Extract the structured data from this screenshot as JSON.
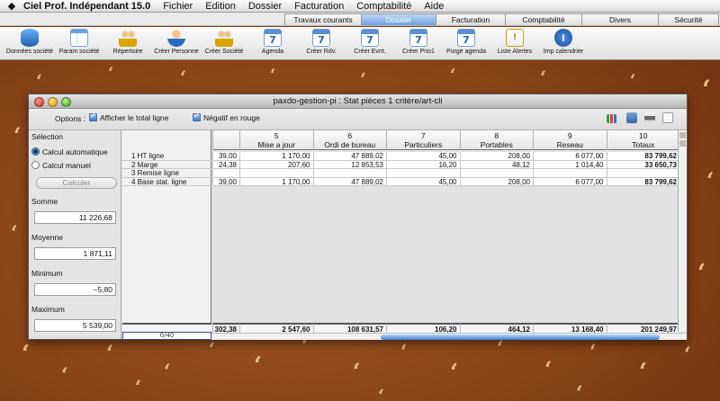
{
  "menubar": {
    "app_name": "Ciel Prof. Indépendant 15.0",
    "items": [
      "Fichier",
      "Edition",
      "Dossier",
      "Facturation",
      "Comptabilité",
      "Aide"
    ]
  },
  "tabs": [
    {
      "label": "Travaux courants",
      "active": false
    },
    {
      "label": "Dossier",
      "active": true
    },
    {
      "label": "Facturation",
      "active": false
    },
    {
      "label": "Comptabilité",
      "active": false
    },
    {
      "label": "Divers",
      "active": false
    },
    {
      "label": "Sécurité",
      "active": false
    }
  ],
  "toolbar": [
    {
      "label": "Données société",
      "icon": "database-info-icon"
    },
    {
      "label": "Param société",
      "icon": "window-settings-icon"
    },
    {
      "label": "Répertoire",
      "icon": "directory-people-icon"
    },
    {
      "label": "Créer Personne",
      "icon": "add-person-icon"
    },
    {
      "label": "Créer Société",
      "icon": "add-company-icon"
    },
    {
      "label": "Agenda",
      "icon": "calendar-icon",
      "cal": "7"
    },
    {
      "label": "Créer Rdv.",
      "icon": "calendar-icon",
      "cal": "7"
    },
    {
      "label": "Créer Evnt.",
      "icon": "calendar-icon",
      "cal": "7"
    },
    {
      "label": "Créer Prio1",
      "icon": "calendar-icon",
      "cal": "7"
    },
    {
      "label": "Purge agenda",
      "icon": "calendar-icon",
      "cal": "7"
    },
    {
      "label": "Liste Alertes",
      "icon": "warning-icon"
    },
    {
      "label": "Imp calendrier",
      "icon": "info-icon"
    }
  ],
  "window": {
    "title": "paxdo-gestion-pi : Stat pièces 1 critère/art-cli",
    "options_label": "Options :",
    "opt_total": "Afficher le total ligne",
    "opt_negative": "Négatif en rouge"
  },
  "left_panel": {
    "selection": "Sélection",
    "auto": "Calcul automatique",
    "manual": "Calcul manuel",
    "calculate": "Calculer",
    "somme_label": "Somme",
    "somme": "11 226,68",
    "moyenne_label": "Moyenne",
    "moyenne": "1 871,11",
    "minimum_label": "Minimum",
    "minimum": "−5,80",
    "maximum_label": "Maximum",
    "maximum": "5 539,00"
  },
  "grid": {
    "partial_col": {
      "num": "",
      "name": "",
      "cells": [
        "39,00",
        "24,38",
        "",
        "39,00"
      ],
      "total": "302,38"
    },
    "columns": [
      {
        "num": "5",
        "name": "Mise a jour",
        "cells": [
          "1 170,00",
          "207,60",
          "",
          "1 170,00"
        ],
        "total": "2 547,60"
      },
      {
        "num": "6",
        "name": "Ordi de bureau",
        "cells": [
          "47 889,02",
          "12 853,53",
          "",
          "47 889,02"
        ],
        "total": "108 631,57"
      },
      {
        "num": "7",
        "name": "Particuliers",
        "cells": [
          "45,00",
          "16,20",
          "",
          "45,00"
        ],
        "total": "106,20"
      },
      {
        "num": "8",
        "name": "Portables",
        "cells": [
          "208,00",
          "48,12",
          "",
          "208,00"
        ],
        "total": "464,12"
      },
      {
        "num": "9",
        "name": "Reseau",
        "cells": [
          "6 077,00",
          "1 014,40",
          "",
          "6 077,00"
        ],
        "total": "13 168,40"
      },
      {
        "num": "10",
        "name": "Totaux",
        "cells": [
          "83 799,62",
          "33 650,73",
          "",
          "83 799,62"
        ],
        "total": "201 249,97"
      }
    ],
    "rows": [
      "1 HT ligne",
      "2 Marge",
      "3 Remise ligne",
      "4 Base stat. ligne"
    ],
    "record_counter": "0/40"
  }
}
